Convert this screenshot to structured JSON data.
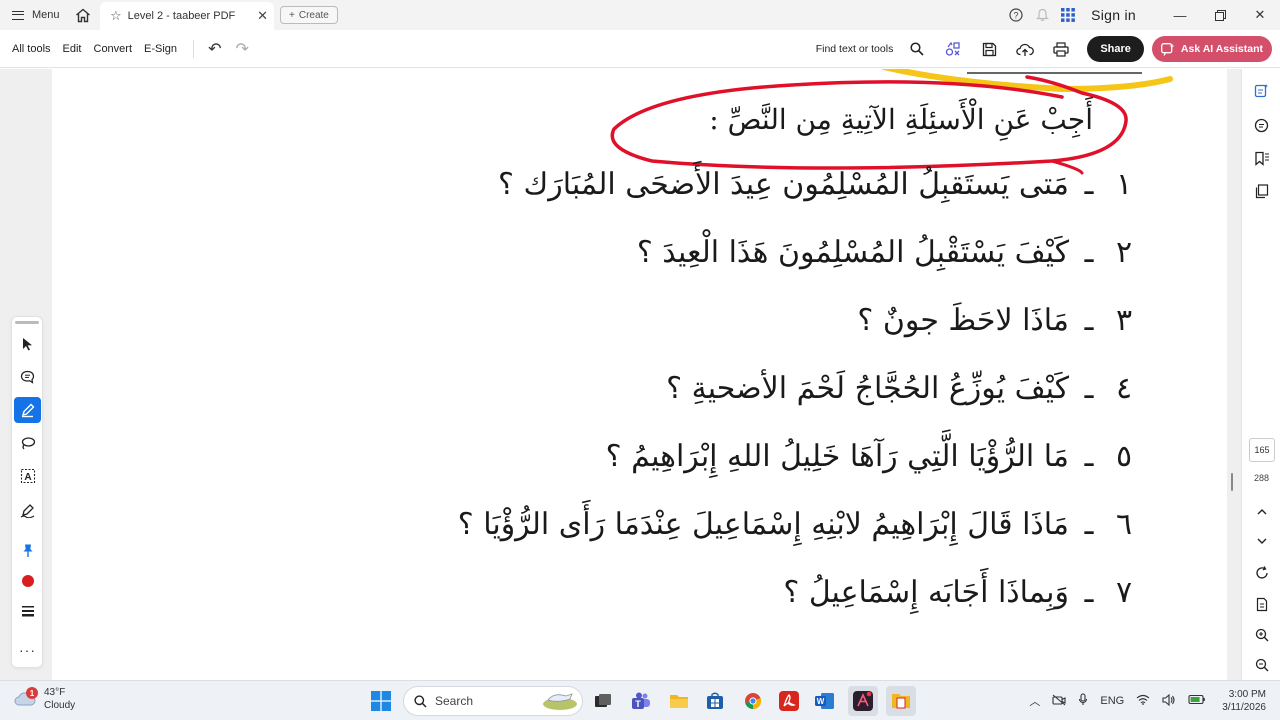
{
  "titlebar": {
    "menu_label": "Menu",
    "tab_title": "Level 2 - taabeer PDF",
    "create_label": "Create",
    "signin_label": "Sign in"
  },
  "toolbar": {
    "items": [
      "All tools",
      "Edit",
      "Convert",
      "E-Sign"
    ],
    "find_label": "Find text or tools",
    "share_label": "Share",
    "ai_label": "Ask AI Assistant"
  },
  "document": {
    "heading": "أَجِبْ عَنِ الْأَسئِلَةِ الآتِيةِ مِن النَّصِّ :",
    "questions": [
      {
        "num": "١",
        "text": "مَتى يَستَقبِلُ المُسْلِمُون عِيدَ الأَضحَى المُبَارَك ؟"
      },
      {
        "num": "٢",
        "text": "كَيْفَ يَسْتَقْبِلُ المُسْلِمُونَ هَذَا الْعِيدَ ؟"
      },
      {
        "num": "٣",
        "text": "مَاذَا لاحَظَ جونٌ ؟"
      },
      {
        "num": "٤",
        "text": "كَيْفَ يُوزِّعُ الحُجَّاجُ لَحْمَ الأضحيةِ ؟"
      },
      {
        "num": "٥",
        "text": "مَا الرُّؤْيَا الَّتِي رَآهَا خَلِيلُ اللهِ إِبْرَاهِيمُ ؟"
      },
      {
        "num": "٦",
        "text": "مَاذَا قَالَ إِبْرَاهِيمُ لابْنِهِ إِسْمَاعِيلَ عِنْدَمَا رَأَى الرُّؤْيَا ؟"
      },
      {
        "num": "٧",
        "text": "وَبِماذَا أَجَابَه إِسْمَاعِيلُ ؟"
      }
    ],
    "dash": "ـ"
  },
  "right_rail": {
    "current_page": "165",
    "total_pages": "288"
  },
  "taskbar": {
    "weather_temp": "43°F",
    "weather_desc": "Cloudy",
    "weather_badge": "1",
    "search_placeholder": "Search",
    "lang": "ENG",
    "time": "3:00 PM",
    "date": "3/11/2026"
  },
  "colors": {
    "annotation_red": "#e0102a",
    "highlight_yellow": "#f5c518",
    "ai_button": "#d4506a",
    "active_tool": "#1473e6"
  }
}
